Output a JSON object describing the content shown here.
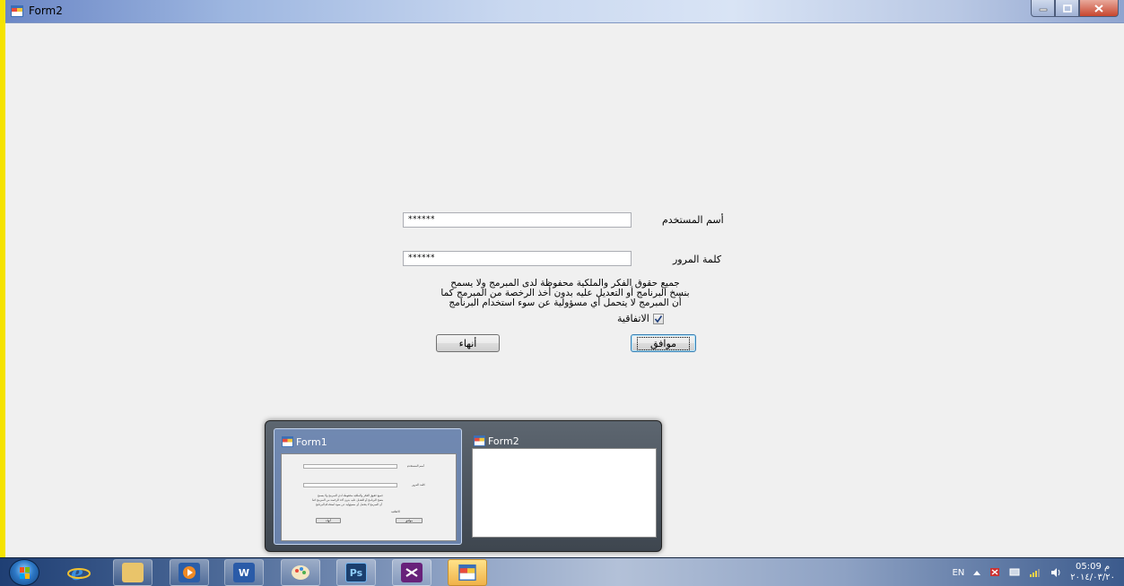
{
  "window": {
    "title": "Form2"
  },
  "form": {
    "username_label": "أسم المستخدم",
    "username_value": "******",
    "password_label": "كلمة المرور",
    "password_value": "******",
    "notice_lines": [
      "جميع حقوق الفكر والملكية محفوظة لدى المبرمج ولا يسمح",
      "بنسخ البرنامج أو التعديل عليه بدون أخذ الرخصة من المبرمج كما",
      "أن المبرمج لا يتحمل أي مسؤولية عن سوء استخدام البرنامج"
    ],
    "agreement_label": "الاتفاقية",
    "agreement_checked": true,
    "ok_button": "موافق",
    "exit_button": "أنهاء"
  },
  "switcher": {
    "windows": [
      {
        "title": "Form1",
        "active": true
      },
      {
        "title": "Form2",
        "active": false
      }
    ]
  },
  "taskbar": {
    "items": [
      "internet-explorer",
      "file-explorer",
      "media-player",
      "word",
      "paint",
      "photoshop",
      "visual-studio",
      "form-app"
    ],
    "photoshop_label": "Ps",
    "language": "EN",
    "time": "05:09 م",
    "date": "٢٠١٤/٠٣/٢٠"
  }
}
